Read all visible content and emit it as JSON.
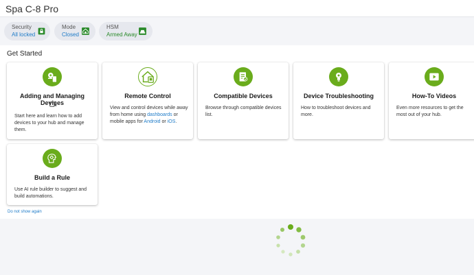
{
  "header": {
    "hub_name": "Spa C-8 Pro"
  },
  "status": [
    {
      "label": "Security",
      "value": "All locked",
      "icon": "lock-icon",
      "value_color": "#1e7bc8"
    },
    {
      "label": "Mode",
      "value": "Closed",
      "icon": "home-icon",
      "value_color": "#1e7bc8"
    },
    {
      "label": "HSM",
      "value": "Armed Away",
      "icon": "shield-car-icon",
      "value_color": "#2a8a2a"
    }
  ],
  "colors": {
    "accent": "#6aac1c",
    "link": "#1e7bc8"
  },
  "get_started": {
    "title": "Get Started",
    "cards": [
      {
        "title": "Adding and Managing Devices",
        "icon": "add-device-icon",
        "extra_icon": "video-icon",
        "desc": "Start here and learn how to add devices to your hub and manage them."
      },
      {
        "title": "Remote Control",
        "icon": "remote-home-icon",
        "desc_pre": "View and control devices while away from home using ",
        "link1": "dashboards",
        "desc_mid": " or mobile apps for ",
        "link2": "Android",
        "desc_or": " or ",
        "link3": "iOS",
        "desc_end": "."
      },
      {
        "title": "Compatible Devices",
        "icon": "device-list-icon",
        "desc": "Browse through compatible devices list."
      },
      {
        "title": "Device Troubleshooting",
        "icon": "troubleshoot-icon",
        "desc": "How to troubleshoot devices and more."
      },
      {
        "title": "How-To Videos",
        "icon": "video-player-icon",
        "desc": "Even more resources to get the most out of your hub."
      },
      {
        "title": "Build a Rule",
        "icon": "ai-rule-icon",
        "desc": "Use AI rule builder to suggest and build automations."
      }
    ],
    "hide_link": "Do not show again"
  }
}
